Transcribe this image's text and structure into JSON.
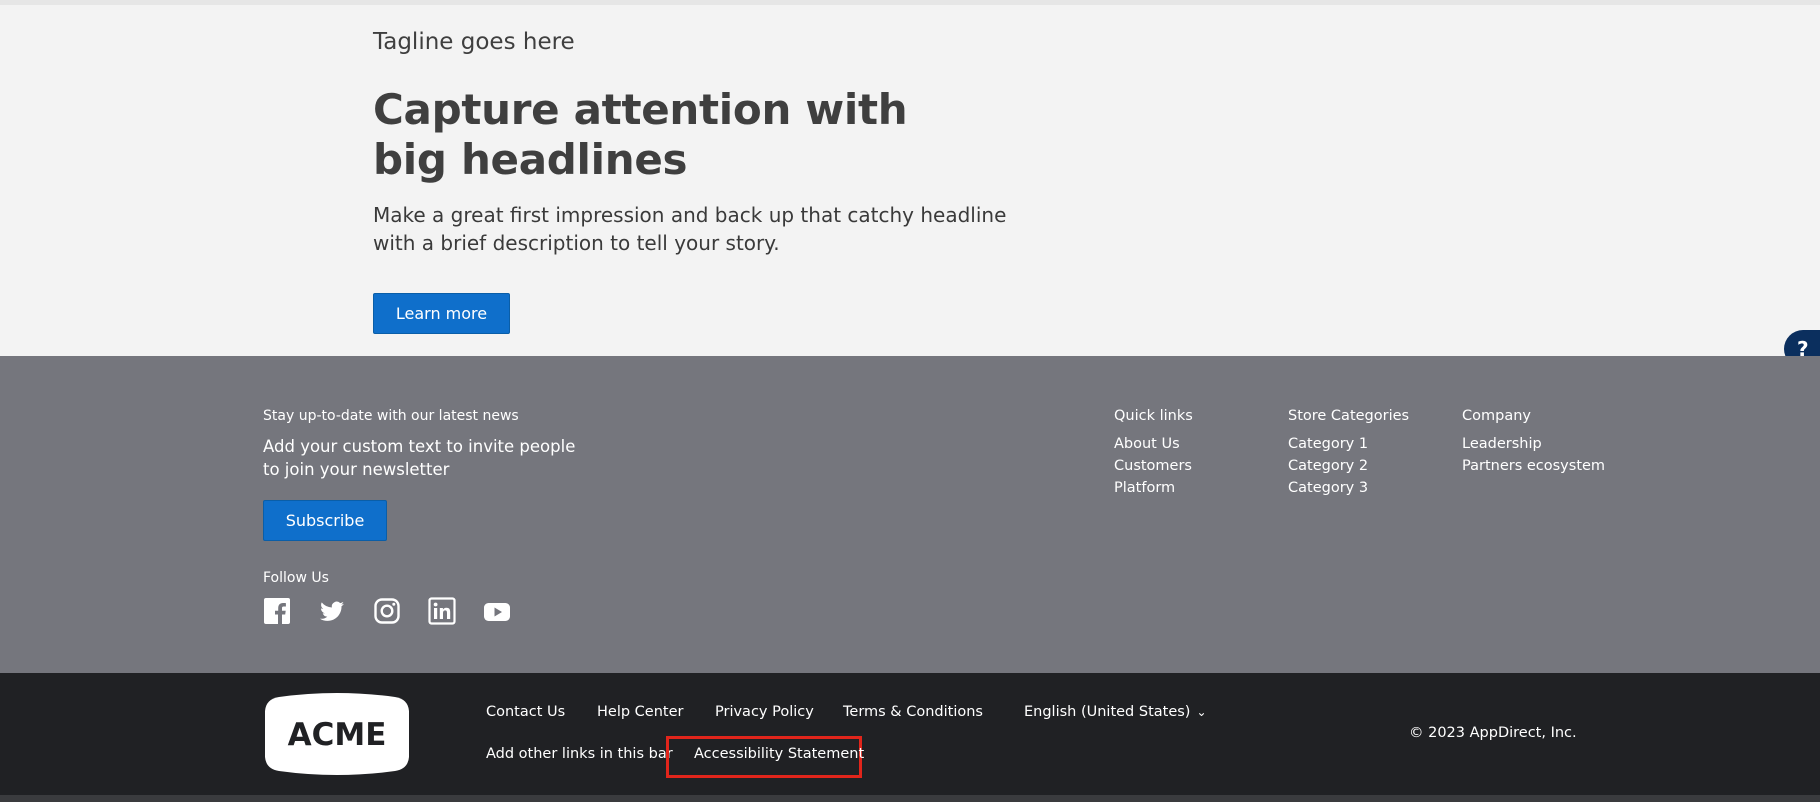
{
  "hero": {
    "tagline": "Tagline goes here",
    "headline": "Capture attention with big headlines",
    "description": "Make a great first impression and back up that catchy headline with a brief description to tell your story.",
    "cta_label": "Learn more"
  },
  "help": {
    "label": "?"
  },
  "newsletter": {
    "small_label": "Stay up-to-date with our latest news",
    "text": "Add your custom text to invite people to join your newsletter",
    "subscribe_label": "Subscribe"
  },
  "follow": {
    "label": "Follow Us",
    "icons": [
      "facebook-icon",
      "twitter-icon",
      "instagram-icon",
      "linkedin-icon",
      "youtube-icon"
    ]
  },
  "columns": [
    {
      "title": "Quick links",
      "links": [
        "About Us",
        "Customers",
        "Platform"
      ]
    },
    {
      "title": "Store Categories",
      "links": [
        "Category 1",
        "Category 2",
        "Category 3"
      ]
    },
    {
      "title": "Company",
      "links": [
        "Leadership",
        "Partners ecosystem"
      ]
    }
  ],
  "bottom_bar": {
    "logo_text": "ACME",
    "links": [
      "Contact Us",
      "Help Center",
      "Privacy Policy",
      "Terms & Conditions",
      "Add other links in this bar",
      "Accessibility Statement"
    ],
    "language": "English (United States)",
    "copyright": "© 2023 AppDirect, Inc."
  },
  "colors": {
    "hero_bg": "#f3f3f3",
    "footer_bg": "#75767d",
    "bar_bg": "#202124",
    "button_blue": "#0f6fcb",
    "highlight_red": "#e1251b"
  }
}
